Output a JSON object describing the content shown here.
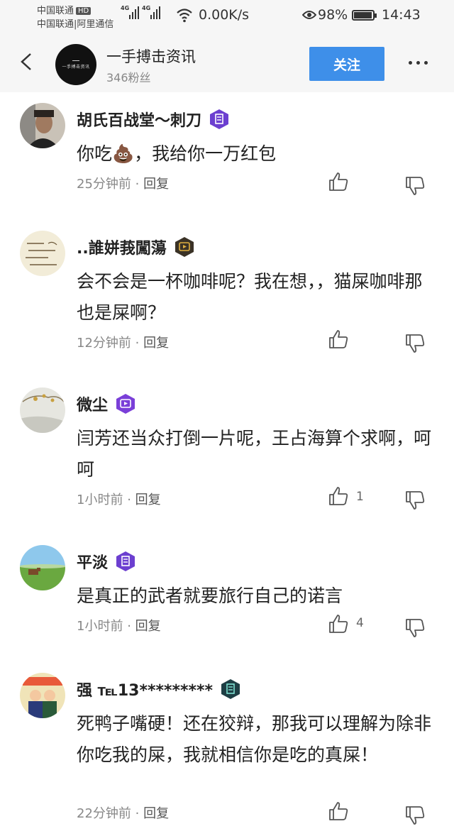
{
  "status_bar": {
    "carrier_1": "中国联通",
    "hd_badge": "HD",
    "carrier_2": "中国联通|阿里通信",
    "signal_1_label": "4G",
    "signal_2_label": "4G",
    "net_speed": "0.00K/s",
    "battery_percent": "98%",
    "battery_level": 0.98,
    "time": "14:43"
  },
  "header": {
    "avatar_text": "一手搏击资讯",
    "channel_name": "一手搏击资讯",
    "fans": "346粉丝",
    "follow_label": "关注"
  },
  "comments": [
    {
      "name": "胡氏百战堂～刺刀",
      "text": "你吃💩，我给你一万红包",
      "time": "25分钟前",
      "reply": "回复",
      "likes": "",
      "badge": "blue-badge-icon"
    },
    {
      "name": "..誰姘莪闖蕩",
      "text": "会不会是一杯咖啡呢？我在想，，猫屎咖啡那也是屎啊？",
      "time": "12分钟前",
      "reply": "回复",
      "likes": "",
      "badge": "gold-video-badge-icon"
    },
    {
      "name": "微尘",
      "text": "闫芳还当众打倒一片呢，王占海算个求啊，呵呵",
      "time": "1小时前",
      "reply": "回复",
      "likes": "1",
      "badge": "purple-video-badge-icon"
    },
    {
      "name": "平淡",
      "text": "是真正的武者就要旅行自己的诺言",
      "time": "1小时前",
      "reply": "回复",
      "likes": "4",
      "badge": "blue-badge-icon"
    },
    {
      "name": "强 ℡13*********",
      "text": "死鸭子嘴硬！还在狡辩，那我可以理解为除非你吃我的屎，我就相信你是吃的真屎！",
      "time": "22分钟前",
      "reply": "回复",
      "likes": "",
      "badge": "teal-badge-icon"
    }
  ],
  "separator": "·"
}
